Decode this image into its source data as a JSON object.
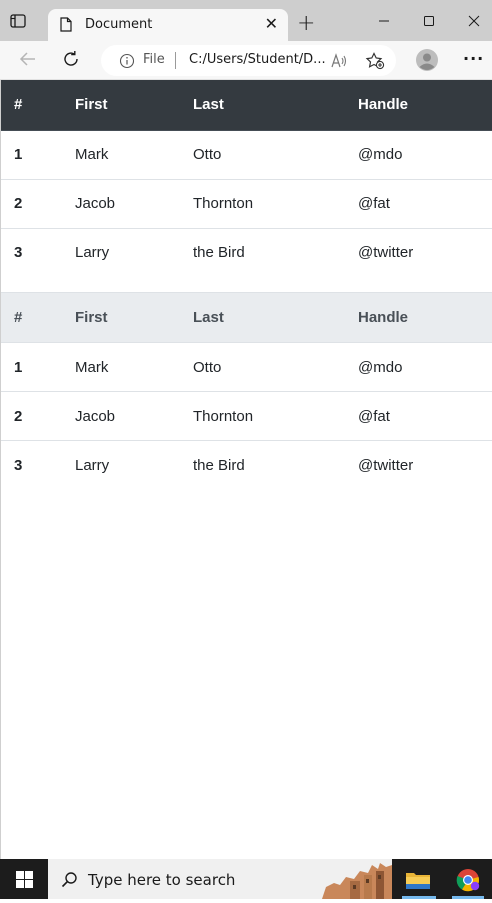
{
  "browser": {
    "tab_title": "Document",
    "address_scheme": "File",
    "address_url": "C:/Users/Student/D..."
  },
  "tables": [
    {
      "header_style": "dark",
      "headers": [
        "#",
        "First",
        "Last",
        "Handle"
      ],
      "rows": [
        [
          "1",
          "Mark",
          "Otto",
          "@mdo"
        ],
        [
          "2",
          "Jacob",
          "Thornton",
          "@fat"
        ],
        [
          "3",
          "Larry",
          "the Bird",
          "@twitter"
        ]
      ]
    },
    {
      "header_style": "light",
      "headers": [
        "#",
        "First",
        "Last",
        "Handle"
      ],
      "rows": [
        [
          "1",
          "Mark",
          "Otto",
          "@mdo"
        ],
        [
          "2",
          "Jacob",
          "Thornton",
          "@fat"
        ],
        [
          "3",
          "Larry",
          "the Bird",
          "@twitter"
        ]
      ]
    }
  ],
  "taskbar": {
    "search_placeholder": "Type here to search"
  },
  "colors": {
    "dark_header_bg": "#343a40",
    "light_header_bg": "#e9ecef",
    "row_border": "#dee2e6"
  }
}
